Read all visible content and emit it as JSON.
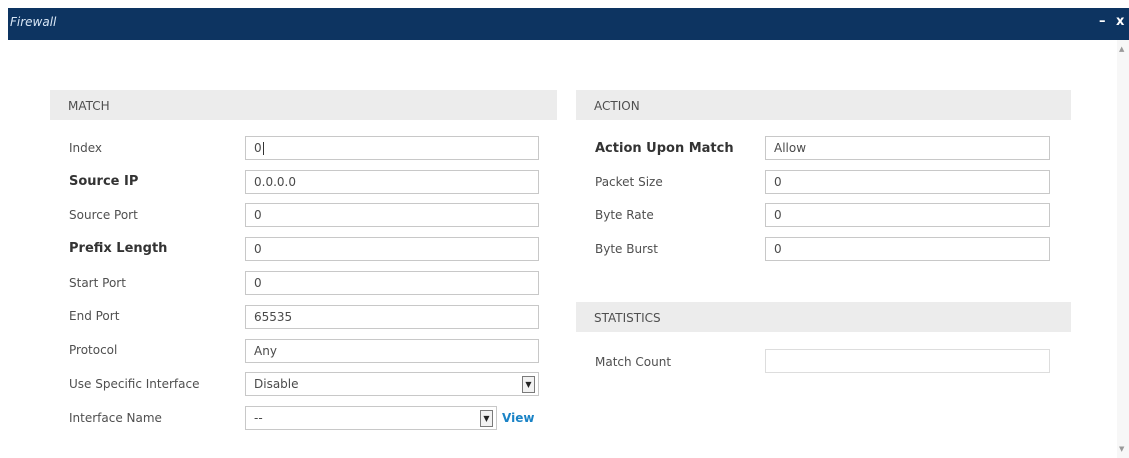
{
  "window": {
    "title": "Firewall",
    "minimize_label": "–",
    "close_label": "x"
  },
  "match": {
    "heading": "MATCH",
    "rows": [
      {
        "label": "Index",
        "value": "0"
      },
      {
        "label": "Source IP",
        "value": "0.0.0.0"
      },
      {
        "label": "Source Port",
        "value": "0"
      },
      {
        "label": "Prefix Length",
        "value": "0"
      },
      {
        "label": "Start Port",
        "value": "0"
      },
      {
        "label": "End Port",
        "value": "65535"
      },
      {
        "label": "Protocol",
        "value": "Any"
      },
      {
        "label": "Use Specific Interface",
        "value": "Disable"
      },
      {
        "label": "Interface Name",
        "value": "--"
      }
    ],
    "view_link": "View"
  },
  "action": {
    "heading": "ACTION",
    "rows": [
      {
        "label": "Action Upon Match",
        "value": "Allow"
      },
      {
        "label": "Packet Size",
        "value": "0"
      },
      {
        "label": "Byte Rate",
        "value": "0"
      },
      {
        "label": "Byte Burst",
        "value": "0"
      }
    ]
  },
  "statistics": {
    "heading": "STATISTICS",
    "rows": [
      {
        "label": "Match Count",
        "value": ""
      }
    ]
  },
  "icons": {
    "scroll_up": "triangle-up-icon",
    "scroll_down": "triangle-down-icon",
    "dropdown": "triangle-down-icon"
  }
}
